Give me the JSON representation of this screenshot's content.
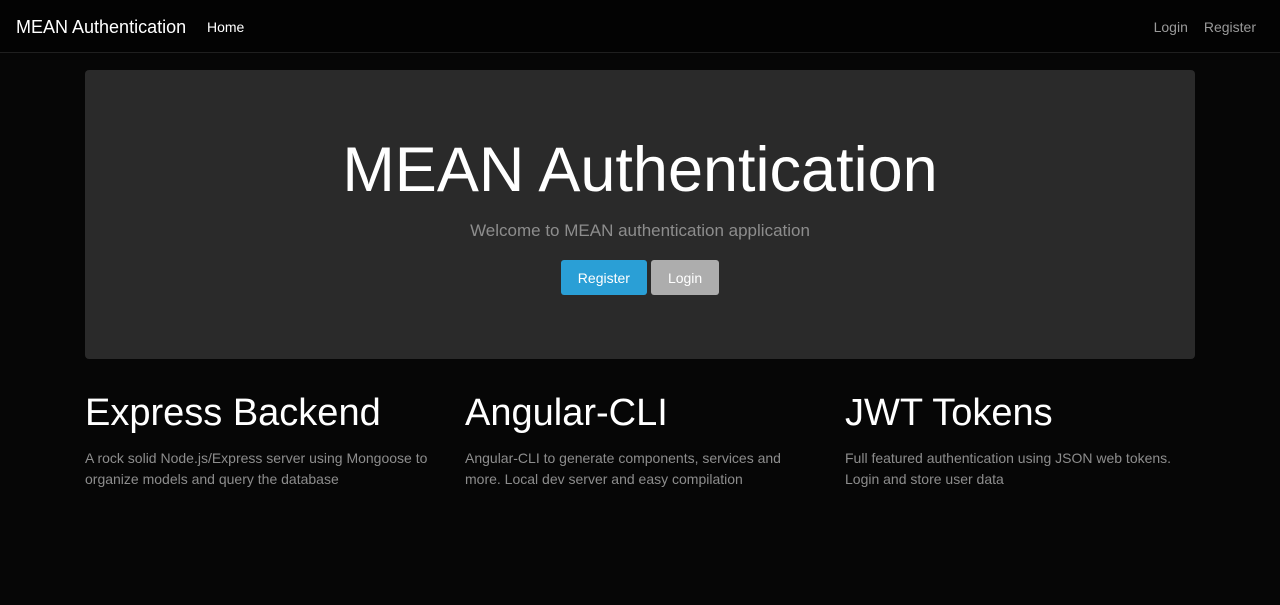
{
  "navbar": {
    "brand": "MEAN Authentication",
    "home": "Home",
    "login": "Login",
    "register": "Register"
  },
  "jumbotron": {
    "title": "MEAN Authentication",
    "lead": "Welcome to MEAN authentication application",
    "register_label": "Register",
    "login_label": "Login"
  },
  "features": [
    {
      "title": "Express Backend",
      "text": "A rock solid Node.js/Express server using Mongoose to organize models and query the database"
    },
    {
      "title": "Angular-CLI",
      "text": "Angular-CLI to generate components, services and more. Local dev server and easy compilation"
    },
    {
      "title": "JWT Tokens",
      "text": "Full featured authentication using JSON web tokens. Login and store user data"
    }
  ],
  "colors": {
    "primary": "#2a9fd6",
    "default": "#adadad",
    "jumbotron_bg": "#2a2a2a",
    "page_bg": "#060606"
  }
}
